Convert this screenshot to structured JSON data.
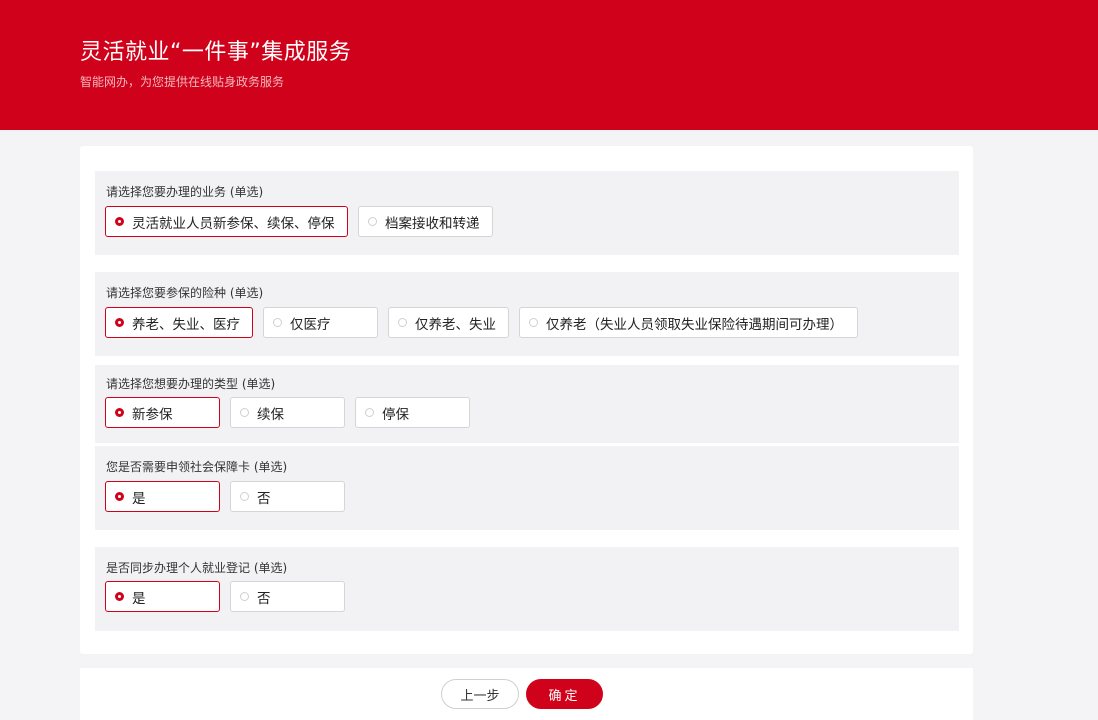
{
  "header": {
    "title": "灵活就业“一件事”集成服务",
    "subtitle": "智能网办，为您提供在线贴身政务服务"
  },
  "form": {
    "sections": [
      {
        "label": "请选择您要办理的业务 (单选)",
        "options": [
          {
            "label": "灵活就业人员新参保、续保、停保",
            "selected": true
          },
          {
            "label": "档案接收和转递",
            "selected": false
          }
        ]
      },
      {
        "label": "请选择您要参保的险种 (单选)",
        "options": [
          {
            "label": "养老、失业、医疗",
            "selected": true
          },
          {
            "label": "仅医疗",
            "selected": false
          },
          {
            "label": "仅养老、失业",
            "selected": false
          },
          {
            "label": "仅养老（失业人员领取失业保险待遇期间可办理）",
            "selected": false
          }
        ]
      },
      {
        "label": "请选择您想要办理的类型 (单选)",
        "options": [
          {
            "label": "新参保",
            "selected": true
          },
          {
            "label": "续保",
            "selected": false
          },
          {
            "label": "停保",
            "selected": false
          }
        ]
      },
      {
        "label": "您是否需要申领社会保障卡 (单选)",
        "options": [
          {
            "label": "是",
            "selected": true
          },
          {
            "label": "否",
            "selected": false
          }
        ]
      },
      {
        "label": "是否同步办理个人就业登记 (单选)",
        "options": [
          {
            "label": "是",
            "selected": true
          },
          {
            "label": "否",
            "selected": false
          }
        ]
      }
    ]
  },
  "footer": {
    "prev_label": "上一步",
    "confirm_label": "确定"
  },
  "colors": {
    "brand_red": "#d0021b",
    "page_background": "#f4f4f6",
    "section_background": "#f2f2f4"
  }
}
